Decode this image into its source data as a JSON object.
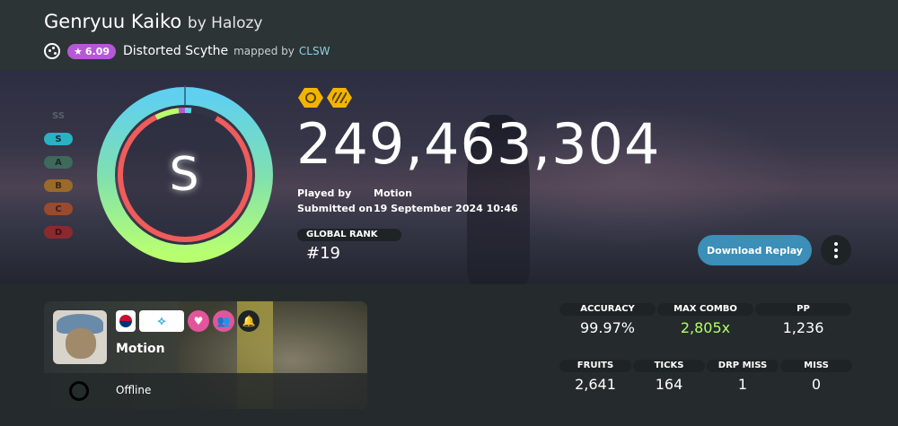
{
  "header": {
    "song_title": "Genryuu Kaiko",
    "by_artist": "by Halozy",
    "star_rating": "6.09",
    "difficulty": "Distorted Scythe",
    "mapped_by": "mapped by",
    "mapper": "CLSW"
  },
  "grades": [
    "SS",
    "S",
    "A",
    "B",
    "C",
    "D"
  ],
  "score": {
    "rank": "S",
    "total": "249,463,304",
    "played_by_label": "Played by",
    "played_by": "Motion",
    "submitted_label": "Submitted on",
    "submitted_on": "19 September 2024 10:46",
    "global_rank_label": "GLOBAL RANK",
    "global_rank": "#19",
    "accuracy_fraction": 0.9997,
    "mods": [
      "hidden-mod-icon",
      "hardrock-mod-icon"
    ]
  },
  "actions": {
    "download_label": "Download Replay"
  },
  "user": {
    "name": "Motion",
    "status": "Offline",
    "country": "KR"
  },
  "stats": {
    "accuracy_label": "ACCURACY",
    "accuracy": "99.97%",
    "max_combo_label": "MAX COMBO",
    "max_combo": "2,805x",
    "pp_label": "PP",
    "pp": "1,236",
    "fruits_label": "FRUITS",
    "fruits": "2,641",
    "ticks_label": "TICKS",
    "ticks": "164",
    "drp_miss_label": "DRP MISS",
    "drp_miss": "1",
    "miss_label": "MISS",
    "miss": "0"
  },
  "colors": {
    "star_badge": "#b558d8",
    "accent_blue": "#3b8fb8",
    "combo_green": "#b3ff66",
    "grade_s": "#2ab1c4",
    "mod_yellow": "#f2b400"
  }
}
